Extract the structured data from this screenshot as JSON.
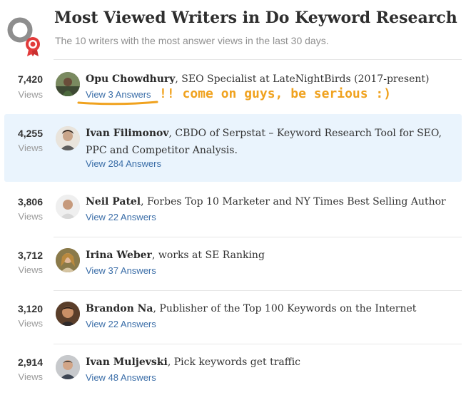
{
  "header": {
    "title": "Most Viewed Writers in Do Keyword Research",
    "subtitle": "The 10 writers with the most answer views in the last 30 days."
  },
  "annotation": {
    "text": "!! come on guys, be serious :)",
    "color": "#f0a21e"
  },
  "colors": {
    "link": "#3b6ea8",
    "highlight_row": "#eaf4fd",
    "badge_ring": "#e23b3b"
  },
  "writers": [
    {
      "views": "7,420",
      "views_label": "Views",
      "name": "Opu Chowdhury",
      "credential": ", SEO Specialist at LateNightBirds (2017-present)",
      "answers": "View 3 Answers"
    },
    {
      "views": "4,255",
      "views_label": "Views",
      "name": "Ivan Filimonov",
      "credential": ", CBDO of Serpstat – Keyword Research Tool for SEO, PPC and Competitor Analysis.",
      "answers": "View 284 Answers"
    },
    {
      "views": "3,806",
      "views_label": "Views",
      "name": "Neil Patel",
      "credential": ", Forbes Top 10 Marketer and NY Times Best Selling Author",
      "answers": "View 22 Answers"
    },
    {
      "views": "3,712",
      "views_label": "Views",
      "name": "Irina Weber",
      "credential": ", works at SE Ranking",
      "answers": "View 37 Answers"
    },
    {
      "views": "3,120",
      "views_label": "Views",
      "name": "Brandon Na",
      "credential": ", Publisher of the Top 100 Keywords on the Internet",
      "answers": "View 22 Answers"
    },
    {
      "views": "2,914",
      "views_label": "Views",
      "name": "Ivan Muljevski",
      "credential": ", Pick keywords get traffic",
      "answers": "View 48 Answers"
    }
  ]
}
